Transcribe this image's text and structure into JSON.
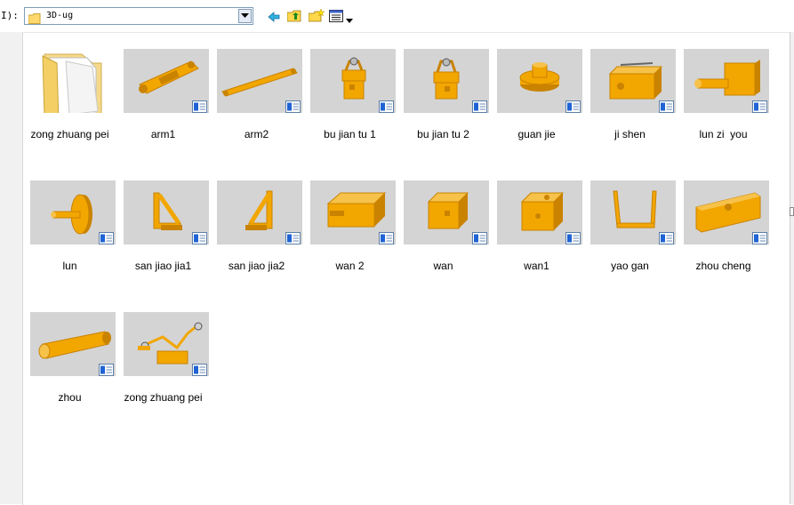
{
  "toolbar": {
    "look_in_label": "I):",
    "location": "3D-ug",
    "icons": [
      "back-icon",
      "up-folder-icon",
      "new-folder-icon",
      "view-menu-icon"
    ]
  },
  "colors": {
    "part": "#f2a600",
    "part_shade": "#c98300",
    "thumb_bg": "#d4d4d4",
    "badge_blue": "#1f63d4"
  },
  "files": [
    {
      "label": "zong zhuang pei",
      "icon": "folder-icon"
    },
    {
      "label": "arm1",
      "icon": "part-thumbnail"
    },
    {
      "label": "arm2",
      "icon": "part-thumbnail"
    },
    {
      "label": "bu jian tu 1",
      "icon": "part-thumbnail"
    },
    {
      "label": "bu jian tu 2",
      "icon": "part-thumbnail"
    },
    {
      "label": "guan jie",
      "icon": "part-thumbnail"
    },
    {
      "label": "ji shen",
      "icon": "part-thumbnail"
    },
    {
      "label": "lun zi  you",
      "icon": "part-thumbnail"
    },
    {
      "label": "lun",
      "icon": "part-thumbnail"
    },
    {
      "label": "san jiao jia1",
      "icon": "part-thumbnail"
    },
    {
      "label": "san jiao jia2",
      "icon": "part-thumbnail"
    },
    {
      "label": "wan 2",
      "icon": "part-thumbnail"
    },
    {
      "label": "wan",
      "icon": "part-thumbnail"
    },
    {
      "label": "wan1",
      "icon": "part-thumbnail"
    },
    {
      "label": "yao gan",
      "icon": "part-thumbnail"
    },
    {
      "label": "zhou cheng",
      "icon": "part-thumbnail"
    },
    {
      "label": "zhou",
      "icon": "part-thumbnail"
    },
    {
      "label": "zong zhuang pei",
      "icon": "part-thumbnail"
    }
  ]
}
